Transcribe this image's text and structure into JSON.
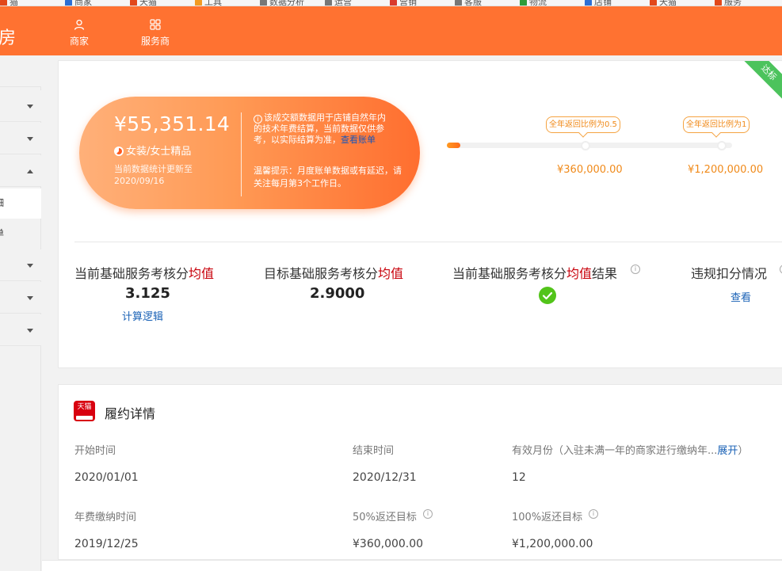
{
  "bookmarks": [
    {
      "label": "猫",
      "color": "#e2481a"
    },
    {
      "label": "商家",
      "color": "#2d6fd4"
    },
    {
      "label": "天猫",
      "color": "#e2481a"
    },
    {
      "label": "工具",
      "color": "#f29b24"
    },
    {
      "label": "数据分析",
      "color": "#777777"
    },
    {
      "label": "运营",
      "color": "#777777"
    },
    {
      "label": "营销",
      "color": "#d93a2c"
    },
    {
      "label": "客服",
      "color": "#777777"
    },
    {
      "label": "物流",
      "color": "#2e9c3a"
    },
    {
      "label": "店铺",
      "color": "#2d6fd4"
    },
    {
      "label": "天猫",
      "color": "#e2481a"
    },
    {
      "label": "服务",
      "color": "#e2481a"
    }
  ],
  "header": {
    "brand": "房",
    "nav": [
      {
        "label": "商家",
        "icon": "user-icon"
      },
      {
        "label": "服务商",
        "icon": "grid-icon"
      }
    ]
  },
  "sidebar": {
    "items": [
      {
        "type": "collapsed"
      },
      {
        "type": "collapsed"
      },
      {
        "type": "expanded"
      },
      {
        "type": "sub",
        "label": "细",
        "active": true
      },
      {
        "type": "sub",
        "label": "单",
        "active": false
      },
      {
        "type": "collapsed"
      },
      {
        "type": "collapsed"
      },
      {
        "type": "collapsed"
      }
    ]
  },
  "summary": {
    "ribbon": "达标",
    "amount": "¥55,351.14",
    "category": "女装/女士精品",
    "update_text": "当前数据统计更新至",
    "update_date": "2020/09/16",
    "note_text": "该成交额数据用于店铺自然年内的技术年费结算，当前数据仅供参考，以实际结算为准，",
    "note_link": "查看账单",
    "tip": "温馨提示：月度账单数据或有延迟，请关注每月第3个工作日。"
  },
  "progress": {
    "current_fraction": 0.046,
    "milestones": [
      {
        "label": "全年返回比例为0.5",
        "amount": "¥360,000.00"
      },
      {
        "label": "全年返回比例为1",
        "amount": "¥1,200,000.00"
      }
    ]
  },
  "metrics": {
    "current": {
      "label": "当前基础服务考核分",
      "hl": "均值",
      "value": "3.125",
      "link": "计算逻辑"
    },
    "target": {
      "label": "目标基础服务考核分",
      "hl": "均值",
      "value": "2.9000"
    },
    "result": {
      "label": "当前基础服务考核分",
      "hl": "均值",
      "label_suffix": "结果",
      "status": "passed"
    },
    "violation": {
      "label": "违规扣分情况",
      "link": "查看"
    }
  },
  "contract": {
    "logo": "天猫",
    "title": "履约详情",
    "start_label": "开始时间",
    "start_value": "2020/01/01",
    "end_label": "结束时间",
    "end_value": "2020/12/31",
    "months_label": "有效月份（入驻未满一年的商家进行缴纳年...",
    "months_expand": "展开",
    "months_close": "）",
    "months_value": "12",
    "fee_label": "年费缴纳时间",
    "fee_value": "2019/12/25",
    "target50_label": "50%返还目标",
    "target50_value": "¥360,000.00",
    "target100_label": "100%返还目标",
    "target100_value": "¥1,200,000.00"
  }
}
